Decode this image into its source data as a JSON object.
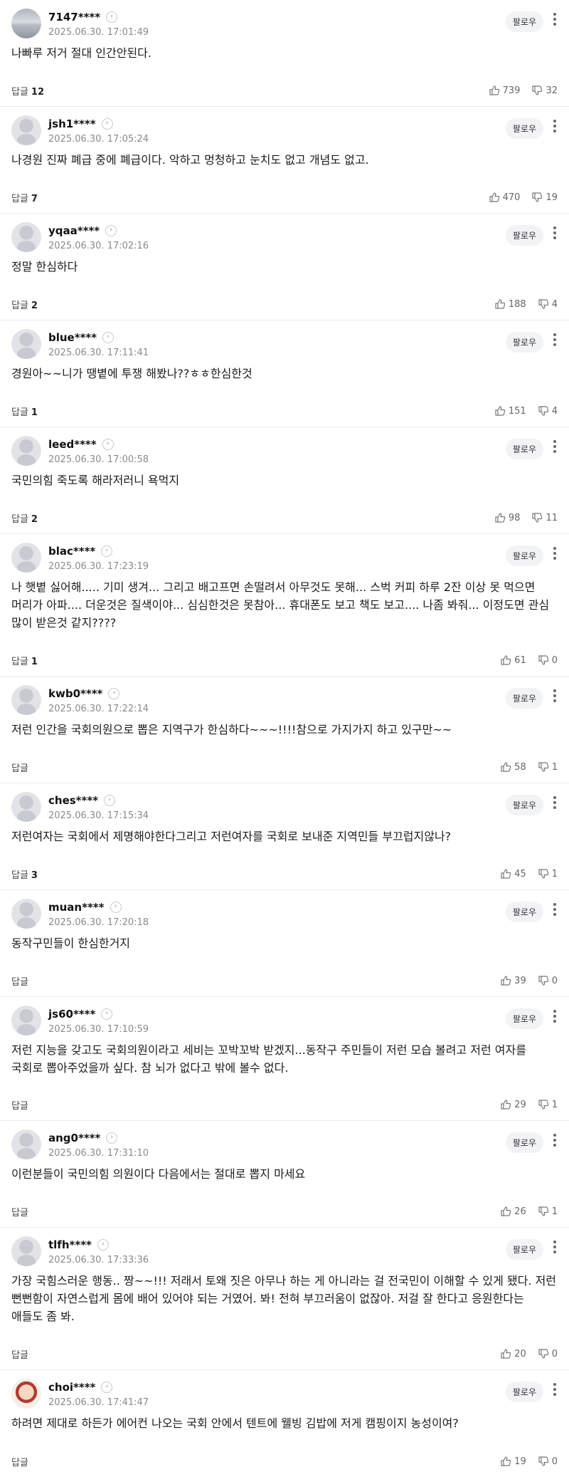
{
  "labels": {
    "follow": "팔로우",
    "reply": "답글"
  },
  "comments": [
    {
      "nick": "7147****",
      "date": "2025.06.30. 17:01:49",
      "text": "나빠루 저거 절대 인간안된다.",
      "replies": "12",
      "likes": "739",
      "dislikes": "32",
      "avatar": "photo"
    },
    {
      "nick": "jsh1****",
      "date": "2025.06.30. 17:05:24",
      "text": "나경원 진짜 폐급 중에 폐급이다. 악하고 멍청하고 눈치도 없고 개념도 없고.",
      "replies": "7",
      "likes": "470",
      "dislikes": "19",
      "avatar": "default"
    },
    {
      "nick": "yqaa****",
      "date": "2025.06.30. 17:02:16",
      "text": "정말 한심하다",
      "replies": "2",
      "likes": "188",
      "dislikes": "4",
      "avatar": "default"
    },
    {
      "nick": "blue****",
      "date": "2025.06.30. 17:11:41",
      "text": "경원아~~니가 땡볕에 투쟁 해봤나??ㅎㅎ한심한것",
      "replies": "1",
      "likes": "151",
      "dislikes": "4",
      "avatar": "default"
    },
    {
      "nick": "leed****",
      "date": "2025.06.30. 17:00:58",
      "text": "국민의힘 죽도록 해라저러니 욕먹지",
      "replies": "2",
      "likes": "98",
      "dislikes": "11",
      "avatar": "default"
    },
    {
      "nick": "blac****",
      "date": "2025.06.30. 17:23:19",
      "text": "나 햇볕 싫어해..... 기미 생겨... 그리고 배고프면 손떨려서 아무것도 못해... 스벅 커피 하루 2잔 이상 못 먹으면 머리가 아파.... 더운것은 질색이야... 심심한것은 못참아... 휴대폰도 보고 책도 보고.... 나좀 봐줘... 이정도면 관심 많이 받은것 같지????",
      "replies": "1",
      "likes": "61",
      "dislikes": "0",
      "avatar": "default"
    },
    {
      "nick": "kwb0****",
      "date": "2025.06.30. 17:22:14",
      "text": "저런 인간을 국회의원으로 뽑은 지역구가 한심하다~~~!!!!참으로 가지가지 하고 있구만~~",
      "replies": "",
      "likes": "58",
      "dislikes": "1",
      "avatar": "default"
    },
    {
      "nick": "ches****",
      "date": "2025.06.30. 17:15:34",
      "text": "저런여자는 국회에서 제명해야한다그리고 저런여자를 국회로 보내준 지역민들 부끄럽지않나?",
      "replies": "3",
      "likes": "45",
      "dislikes": "1",
      "avatar": "default"
    },
    {
      "nick": "muan****",
      "date": "2025.06.30. 17:20:18",
      "text": "동작구민들이 한심한거지",
      "replies": "",
      "likes": "39",
      "dislikes": "0",
      "avatar": "default"
    },
    {
      "nick": "js60****",
      "date": "2025.06.30. 17:10:59",
      "text": "저런 지능을 갖고도 국회의원이라고 세비는 꼬박꼬박 받겠지...동작구 주민들이 저런 모습 볼려고 저런 여자를 국회로 뽑아주었을까 싶다. 참 뇌가 없다고 밖에 볼수 없다.",
      "replies": "",
      "likes": "29",
      "dislikes": "1",
      "avatar": "default"
    },
    {
      "nick": "ang0****",
      "date": "2025.06.30. 17:31:10",
      "text": "이런분들이 국민의힘 의원이다 다음에서는 절대로 뽑지 마세요",
      "replies": "",
      "likes": "26",
      "dislikes": "1",
      "avatar": "default"
    },
    {
      "nick": "tlfh****",
      "date": "2025.06.30. 17:33:36",
      "text": "가장 국힘스러운 행동.. 짱~~!!! 저래서 토왜 짓은 아무나 하는 게 아니라는 걸 전국민이 이해할 수 있게 됐다. 저런 뻔뻔함이 자연스럽게 몸에 배어 있어야 되는 거였어. 봐! 전혀 부끄러움이 없잖아. 저걸 잘 한다고 응원한다는 애들도 좀 봐.",
      "replies": "",
      "likes": "20",
      "dislikes": "0",
      "avatar": "default"
    },
    {
      "nick": "choi****",
      "date": "2025.06.30. 17:41:47",
      "text": "하려면 제대로 하든가 에어컨 나오는 국회 안에서 텐트에 웰빙 김밥에 저게 캠핑이지 농성이여?",
      "replies": "",
      "likes": "19",
      "dislikes": "0",
      "avatar": "char"
    }
  ]
}
